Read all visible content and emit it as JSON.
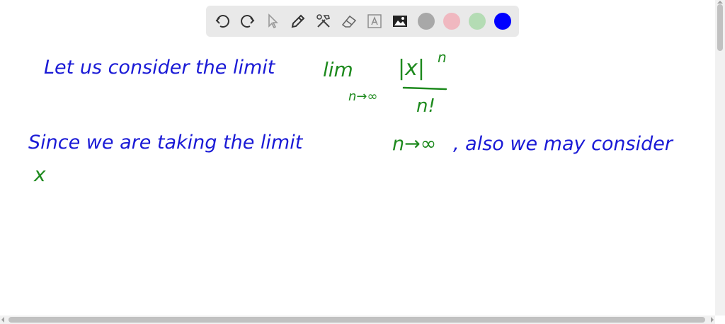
{
  "toolbar": {
    "tools": [
      "undo-icon",
      "redo-icon",
      "pointer-icon",
      "pencil-icon",
      "tools-icon",
      "eraser-icon",
      "text-icon",
      "image-icon"
    ],
    "colors": [
      "#a8a8a8",
      "#f0b8c0",
      "#b4dcb4",
      "#0000ff"
    ],
    "selected_color": "#0000ff"
  },
  "handwriting": {
    "line1_prefix": "Let us consider the limit",
    "lim_word": "lim",
    "lim_subscript": "n→∞",
    "numerator": "|x|",
    "numerator_power": "n",
    "denominator": "n!",
    "line2_prefix": "Since we are taking the limit",
    "line2_math": "n→∞",
    "line2_suffix": ", also we may consider",
    "line3_math": "x"
  },
  "ink_colors": {
    "blue": "#1a1ad6",
    "green": "#1e8a1e"
  }
}
